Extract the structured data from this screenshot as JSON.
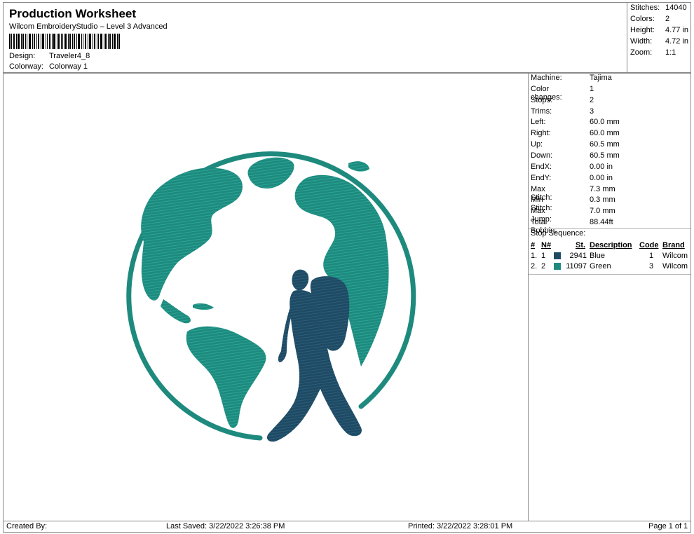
{
  "header": {
    "title": "Production Worksheet",
    "subtitle": "Wilcom EmbroideryStudio – Level 3 Advanced",
    "design_label": "Design:",
    "design_value": "Traveler4_8",
    "colorway_label": "Colorway:",
    "colorway_value": "Colorway 1"
  },
  "stats": [
    {
      "label": "Stitches:",
      "value": "14040"
    },
    {
      "label": "Colors:",
      "value": "2"
    },
    {
      "label": "Height:",
      "value": "4.77 in"
    },
    {
      "label": "Width:",
      "value": "4.72 in"
    },
    {
      "label": "Zoom:",
      "value": "1:1"
    }
  ],
  "machine": [
    {
      "label": "Machine:",
      "value": "Tajima"
    },
    {
      "label": "Color changes:",
      "value": "1"
    },
    {
      "label": "Stops:",
      "value": "2"
    },
    {
      "label": "Trims:",
      "value": "3"
    },
    {
      "label": "Left:",
      "value": "60.0 mm"
    },
    {
      "label": "Right:",
      "value": "60.0 mm"
    },
    {
      "label": "Up:",
      "value": "60.5 mm"
    },
    {
      "label": "Down:",
      "value": "60.5 mm"
    },
    {
      "label": "EndX:",
      "value": "0.00 in"
    },
    {
      "label": "EndY:",
      "value": "0.00 in"
    },
    {
      "label": "Max Stitch:",
      "value": "7.3 mm"
    },
    {
      "label": "Min Stitch:",
      "value": "0.3 mm"
    },
    {
      "label": "Max Jump:",
      "value": "7.0 mm"
    },
    {
      "label": "Total Bobbin:",
      "value": "88.44ft"
    }
  ],
  "stop_sequence": {
    "title": "Stop Sequence:",
    "headers": [
      "#",
      "N#",
      "St.",
      "Description",
      "Code",
      "Brand"
    ],
    "rows": [
      {
        "num": "1.",
        "n": "1",
        "color": "#1f4a63",
        "st": "2941",
        "desc": "Blue",
        "code": "1",
        "brand": "Wilcom"
      },
      {
        "num": "2.",
        "n": "2",
        "color": "#1e8a7e",
        "st": "11097",
        "desc": "Green",
        "code": "3",
        "brand": "Wilcom"
      }
    ]
  },
  "footer": {
    "created": "Created By:",
    "saved": "Last Saved: 3/22/2022 3:26:38 PM",
    "printed": "Printed: 3/22/2022 3:28:01 PM",
    "page": "Page 1 of 1"
  },
  "colors": {
    "green": "#1e8a7e",
    "blue": "#1f4a63"
  }
}
